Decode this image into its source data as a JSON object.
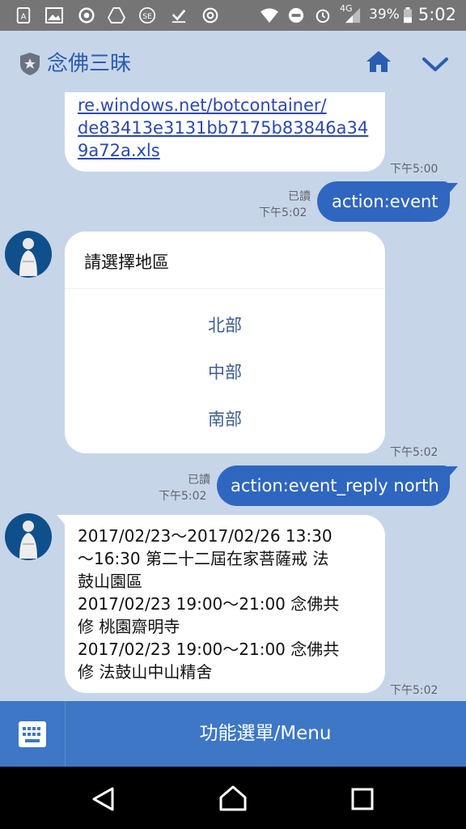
{
  "status_bar": {
    "battery_percent": "39%",
    "network": "4G",
    "time": "5:02"
  },
  "header": {
    "title": "念佛三昧",
    "icons": [
      "shield-star-icon",
      "home-icon",
      "chevron-down-icon"
    ]
  },
  "messages": {
    "link": {
      "lines": [
        "re.windows.net/botcontainer/",
        "de83413e3131bb7175b83846a34",
        "9a72a.xls"
      ],
      "time": "下午5:00"
    },
    "out1": {
      "text": "action:event",
      "read": "已讀",
      "time": "下午5:02"
    },
    "card": {
      "title": "請選擇地區",
      "options": [
        "北部",
        "中部",
        "南部"
      ],
      "time": "下午5:02"
    },
    "out2": {
      "text": "action:event_reply north",
      "read": "已讀",
      "time": "下午5:02"
    },
    "events": {
      "lines": [
        "2017/02/23～2017/02/26 13:30",
        "～16:30 第二十二屆在家菩薩戒 法",
        "鼓山園區",
        "2017/02/23 19:00～21:00 念佛共",
        "修 桃園齋明寺",
        "2017/02/23 19:00～21:00 念佛共",
        "修 法鼓山中山精舍"
      ],
      "time": "下午5:02"
    }
  },
  "bottom_menu": {
    "label": "功能選單/Menu",
    "keyboard_icon": "keyboard-icon"
  },
  "colors": {
    "accent": "#2f66c0",
    "background": "#c7d5e9",
    "menu": "#3d77c6"
  }
}
